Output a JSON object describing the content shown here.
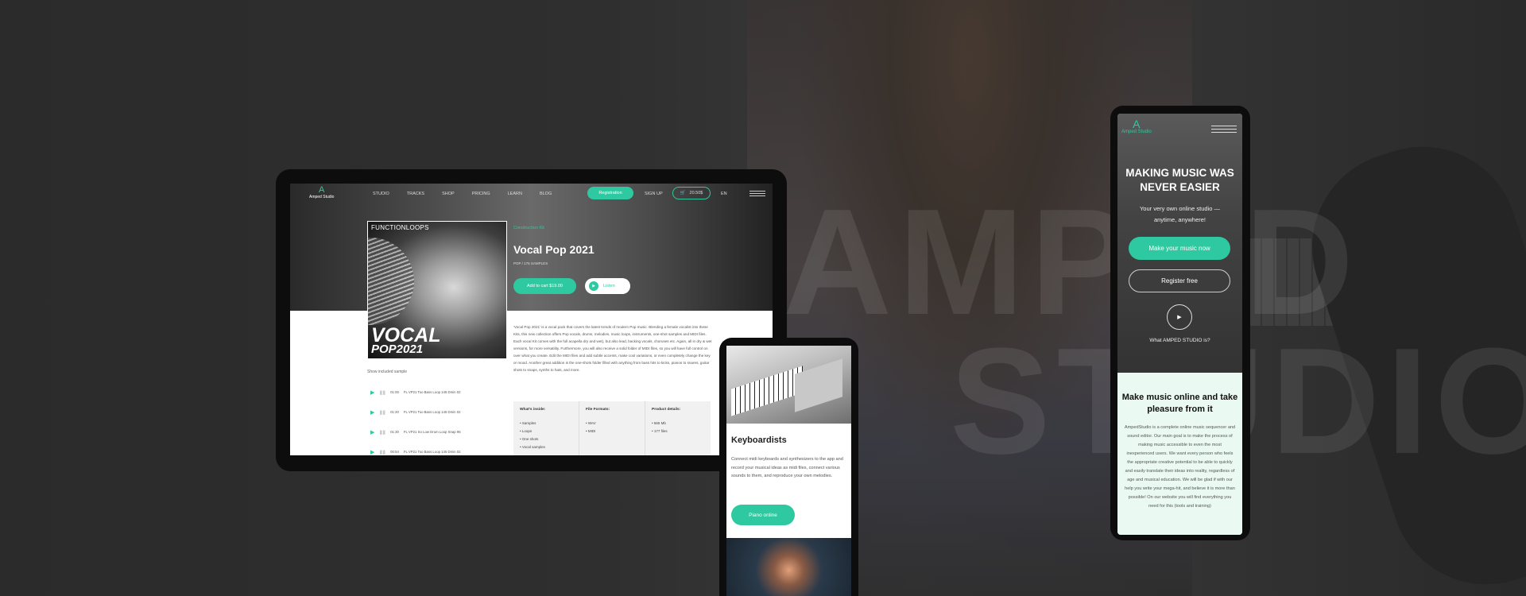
{
  "background": {
    "word1": "AMPED",
    "word2": "STUDIO"
  },
  "desktop": {
    "logo": {
      "mark": "A",
      "text": "Amped Studio"
    },
    "nav": [
      "STUDIO",
      "TRACKS",
      "SHOP",
      "PRICING",
      "LEARN",
      "BLOG"
    ],
    "register_label": "Registration",
    "signin_label": "SIGN UP",
    "cart_value": "20.50$",
    "lang": "EN",
    "cover": {
      "brand": "FUNCTIONLOOPS",
      "line1": "VOCAL",
      "line2": "POP2021"
    },
    "category": "Construction Kit",
    "title": "Vocal Pop 2021",
    "subtitle": "POP / 176 SAMPLES",
    "add_to_cart": "Add to cart $19.00",
    "listen": "Listen",
    "description": "'Vocal Pop 2021' is a vocal pack that covers the latest trends of modern Pop music. Blending a female vocalist into these Kits, this new collection offers Pop vocals, drums, melodies, music loops, instruments, one-shot samples and MIDI files. Each vocal Kit comes with the full acapella dry and wet), but also lead, backing vocals, choruses etc. Again, all in dry & wet versions, for more versatility. Furthermore, you will also receive a solid folder of MIDI files, so you will have full control on over what you create. Edit the MIDI files and add subtle accents, make cool variations, or even completely change the key or mood. Another great addition is the one-shots folder filled with anything from bass hits to kicks, pianos to snares, guitar shots to snaps, synths to hats, and more.",
    "show_samples": "Show included sample",
    "tracks": [
      {
        "time": "01:00",
        "name": "FL VP21 Too Bass Loop 145 Dmin 02"
      },
      {
        "time": "01:20",
        "name": "FL VP21 Too Bass Loop 145 Dmin 02"
      },
      {
        "time": "01:30",
        "name": "FL VP21 So Low Drum Loop Snap 95"
      },
      {
        "time": "00:54",
        "name": "FL VP21 Too Bass Loop 145 Dmin 02"
      }
    ],
    "info": [
      {
        "heading": "What's inside:",
        "items": [
          "Samples",
          "Loops",
          "One shots",
          "Vocal samples"
        ]
      },
      {
        "heading": "File Formats:",
        "items": [
          "WAV",
          "MIDI"
        ]
      },
      {
        "heading": "Product details:",
        "items": [
          "565 Mb",
          "177 files"
        ]
      }
    ]
  },
  "tablet": {
    "heading": "Keyboardists",
    "text": "Connect midi keyboards and synthesizers to the app and record your musical ideas as midi files, connect various sounds to them, and reproduce your own melodies.",
    "button": "Piano online"
  },
  "phone": {
    "logo": {
      "mark": "A",
      "text": "Amped Studio"
    },
    "heading": "MAKING MUSIC WAS NEVER EASIER",
    "sub": "Your very own online studio — anytime, anywhere!",
    "make_button": "Make your music now",
    "register_button": "Register free",
    "what": "What AMPED STUDIO is?",
    "heading2": "Make music online and take pleasure from it",
    "text": "AmpedStudio is a complete online music sequencer and sound editor. Our main goal is to make the process of making music accessible to even the most inexperienced users. We want every person who feels the appropriate creative potential to be able to quickly and easily translate their ideas into reality, regardless of age and musical education. We will be glad if with our help you write your mega-hit, and believe it is more than possible! On our website you will find everything you need for this (tools and training)"
  }
}
